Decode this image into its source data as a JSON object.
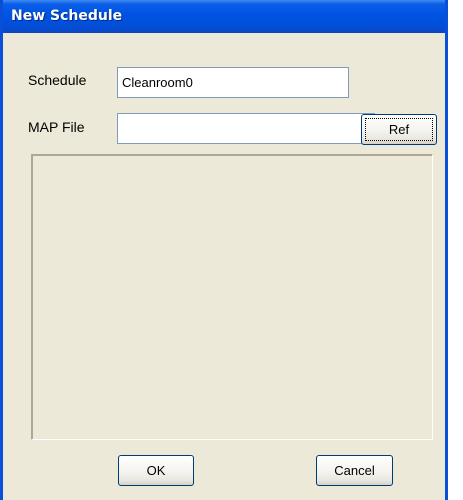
{
  "window": {
    "title": "New Schedule"
  },
  "form": {
    "schedule_label": "Schedule",
    "schedule_value": "Cleanroom0",
    "map_file_label": "MAP File",
    "map_file_value": "",
    "ref_button_label": "Ref"
  },
  "footer": {
    "ok_label": "OK",
    "cancel_label": "Cancel"
  },
  "colors": {
    "title_bar": "#0054e3",
    "dialog_face": "#ece9d8",
    "button_border": "#003c74"
  }
}
